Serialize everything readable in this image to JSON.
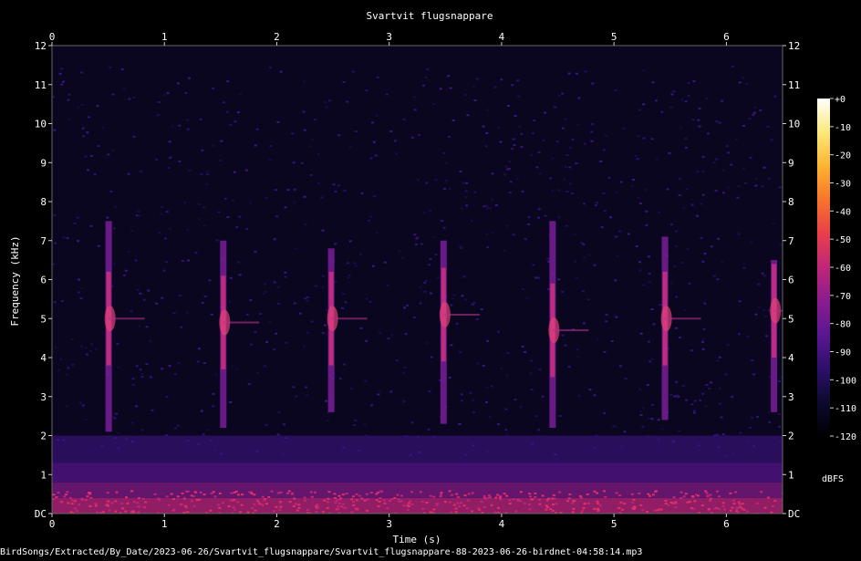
{
  "chart_data": {
    "type": "heatmap",
    "title": "Svartvit flugsnappare",
    "xlabel": "Time (s)",
    "ylabel": "Frequency (kHz)",
    "x_ticks": [
      "0",
      "1",
      "2",
      "3",
      "4",
      "5",
      "6"
    ],
    "y_ticks": [
      "DC",
      "1",
      "2",
      "3",
      "4",
      "5",
      "6",
      "7",
      "8",
      "9",
      "10",
      "11",
      "12"
    ],
    "xlim": [
      0,
      6.5
    ],
    "ylim": [
      0,
      12
    ],
    "colorbar": {
      "label": "dBFS",
      "ticks": [
        "+0",
        "-10",
        "-20",
        "-30",
        "-40",
        "-50",
        "-60",
        "-70",
        "-80",
        "-90",
        "-100",
        "-110",
        "-120"
      ],
      "range": [
        -120,
        0
      ],
      "colormap": "magma",
      "colors": [
        "#000000",
        "#0c0a2e",
        "#2d0f6b",
        "#5a1692",
        "#8a1c8f",
        "#c02678",
        "#e83f4a",
        "#f8742a",
        "#fdb432",
        "#fbe97a",
        "#ffffff"
      ]
    },
    "calls": [
      {
        "t": 0.5,
        "f_low": 2.1,
        "f_high": 7.5,
        "peak_f": 5.0
      },
      {
        "t": 1.52,
        "f_low": 2.2,
        "f_high": 7.0,
        "peak_f": 4.9
      },
      {
        "t": 2.48,
        "f_low": 2.6,
        "f_high": 6.8,
        "peak_f": 5.0
      },
      {
        "t": 3.48,
        "f_low": 2.3,
        "f_high": 7.0,
        "peak_f": 5.1
      },
      {
        "t": 4.45,
        "f_low": 2.2,
        "f_high": 7.5,
        "peak_f": 4.7
      },
      {
        "t": 5.45,
        "f_low": 2.4,
        "f_high": 7.1,
        "peak_f": 5.0
      },
      {
        "t": 6.42,
        "f_low": 2.6,
        "f_high": 6.5,
        "peak_f": 5.2
      }
    ]
  },
  "footer": {
    "filename": "BirdSongs/Extracted/By_Date/2023-06-26/Svartvit_flugsnappare/Svartvit_flugsnappare-88-2023-06-26-birdnet-04:58:14.mp3"
  }
}
